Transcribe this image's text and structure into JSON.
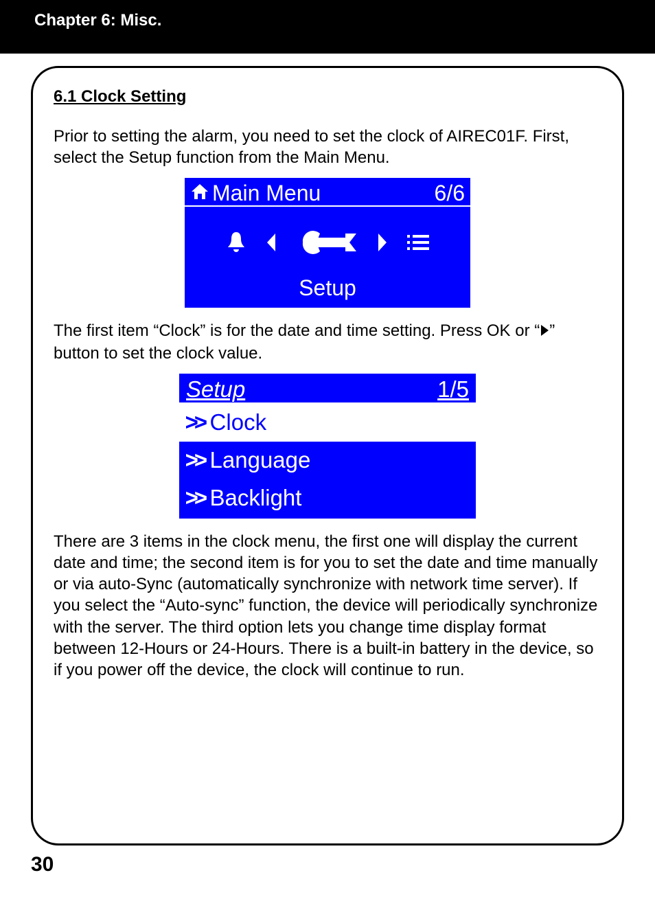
{
  "header": {
    "chapter": "Chapter 6: Misc."
  },
  "section": {
    "title": "6.1 Clock Setting",
    "para1": "Prior to setting the alarm, you need to set the clock of AIREC01F. First, select the Setup function from the Main Menu.",
    "para2a": "The first item “Clock” is for the date and time setting. Press OK or  “",
    "para2b": "” button to set the clock value.",
    "para3": "There are 3 items in the clock menu, the first one will display the current date and time; the second item is for you to set the date and time manually or via auto-Sync (automatically synchronize with network time server). If you select the “Auto-sync” function, the device will periodically synchronize with the server. The third option lets you change time display format between 12-Hours or 24-Hours. There is a built-in battery in the device, so if you power off the device, the clock will continue to run."
  },
  "lcd1": {
    "title": "Main Menu",
    "count": "6/6",
    "label": "Setup"
  },
  "lcd2": {
    "title": "Setup",
    "count": "1/5",
    "items": [
      "Clock",
      "Language",
      "Backlight"
    ]
  },
  "page_number": "30"
}
